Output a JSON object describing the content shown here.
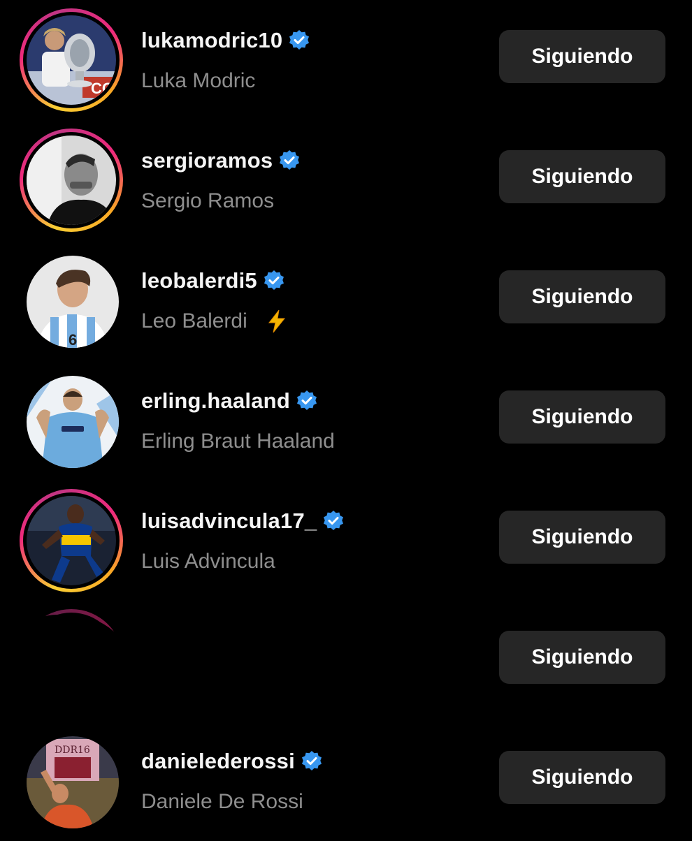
{
  "accounts": [
    {
      "username": "lukamodric10",
      "full_name": "Luka Modric",
      "verified": true,
      "story_ring": true,
      "button_label": "Siguiendo",
      "avatar_icon": "trophy-portrait"
    },
    {
      "username": "sergioramos",
      "full_name": "Sergio Ramos",
      "verified": true,
      "story_ring": true,
      "button_label": "Siguiendo",
      "avatar_icon": "bw-portrait"
    },
    {
      "username": "leobalerdi5",
      "full_name": "Leo Balerdi",
      "verified": true,
      "story_ring": false,
      "button_label": "Siguiendo",
      "avatar_icon": "argentina-jersey-portrait",
      "emoji": "lightning-bolt-icon"
    },
    {
      "username": "erling.haaland",
      "full_name": "Erling Braut Haaland",
      "verified": true,
      "story_ring": false,
      "button_label": "Siguiendo",
      "avatar_icon": "city-jersey-portrait"
    },
    {
      "username": "luisadvincula17_",
      "full_name": "Luis Advincula",
      "verified": true,
      "story_ring": true,
      "button_label": "Siguiendo",
      "avatar_icon": "boca-jersey-portrait"
    },
    {
      "username": "",
      "full_name": "",
      "verified": false,
      "story_ring": true,
      "redacted": true,
      "button_label": "Siguiendo",
      "avatar_icon": "redacted"
    },
    {
      "username": "danielederossi",
      "full_name": "Daniele De Rossi",
      "verified": true,
      "story_ring": false,
      "button_label": "Siguiendo",
      "avatar_icon": "roma-portrait"
    }
  ],
  "colors": {
    "background": "#000000",
    "button": "#262626",
    "verified_badge": "#3897f0",
    "secondary_text": "#8e8e8e"
  }
}
